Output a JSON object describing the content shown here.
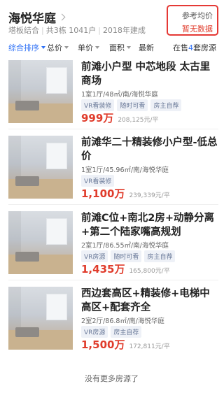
{
  "header": {
    "title": "海悦华庭",
    "subtitle_area": "塔板结合",
    "subtitle_buildings": "共3栋 1041户",
    "subtitle_year": "2018年建成",
    "price_label": "参考均价",
    "price_value": "暂无数据"
  },
  "filters": {
    "sort": "综合排序",
    "total_price": "总价",
    "unit_price": "单价",
    "area": "面积",
    "latest": "最新",
    "count_prefix": "在售",
    "count_num": "4",
    "count_suffix": "套房源"
  },
  "listings": [
    {
      "title": "前滩小户型 中芯地段 太古里商场",
      "info": "1室1厅/48㎡/南/海悦华庭",
      "tags": [
        "VR看装修",
        "随时可看",
        "房主自荐"
      ],
      "price": "999万",
      "unit_price": "208,125元/平"
    },
    {
      "title": "前滩华二十精装修小户型-低总价",
      "info": "1室1厅/45.96㎡/南/海悦华庭",
      "tags": [
        "VR看装修"
      ],
      "price": "1,100万",
      "unit_price": "239,339元/平"
    },
    {
      "title": "前滩C位+南北2房+动静分离+第二个陆家嘴高规划",
      "info": "2室1厅/86.55㎡/南/海悦华庭",
      "tags": [
        "VR房源",
        "随时可看",
        "房主自荐"
      ],
      "price": "1,435万",
      "unit_price": "165,800元/平"
    },
    {
      "title": "西边套高区+精装修+电梯中高区+配套齐全",
      "info": "2室2厅/86.8㎡/南/海悦华庭",
      "tags": [
        "VR房源",
        "房主自荐"
      ],
      "price": "1,500万",
      "unit_price": "172,811元/平"
    }
  ],
  "footer": "没有更多房源了"
}
